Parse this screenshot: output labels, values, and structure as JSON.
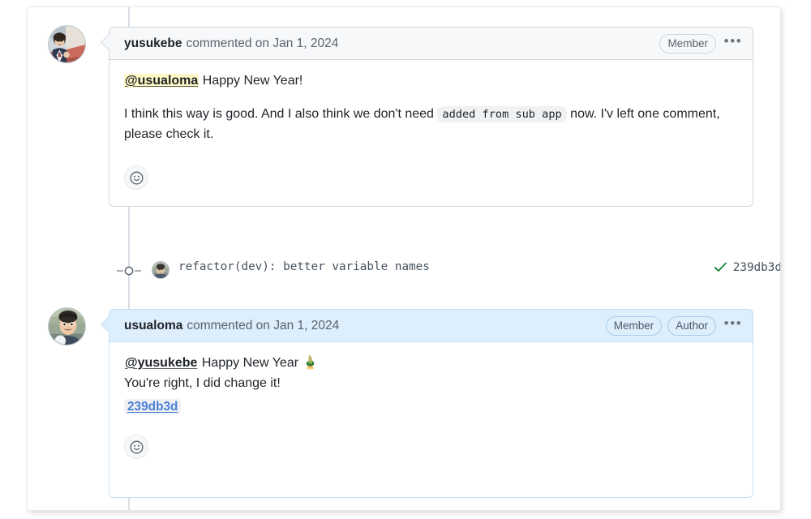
{
  "timeline": {
    "comments": [
      {
        "author": "yusukebe",
        "meta": "commented on Jan 1, 2024",
        "badges": [
          "Member"
        ],
        "kebab_label": "•••",
        "kebab_name": "comment-actions-menu",
        "highlight": "grey",
        "body": {
          "mention": "@usualoma",
          "greeting": " Happy New Year!",
          "paragraph_pre": "I think this way is good. And I also think we don't need ",
          "inline_code": "added from sub app",
          "paragraph_post": " now. I'v left one comment, please check it."
        },
        "reaction_icon": "smiley-face-icon"
      },
      {
        "author": "usualoma",
        "meta": "commented on Jan 1, 2024",
        "badges": [
          "Member",
          "Author"
        ],
        "kebab_label": "•••",
        "kebab_name": "comment-actions-menu",
        "highlight": "blue",
        "body": {
          "mention": "@yusukebe",
          "greeting": " Happy New Year ",
          "emoji": "🎍",
          "line2": "You're right, I did change it!",
          "sha_link": "239db3d"
        },
        "reaction_icon": "smiley-face-icon"
      }
    ],
    "commit_event": {
      "message": "refactor(dev): better variable names",
      "sha": "239db3d",
      "status_icon": "check-icon",
      "status_color": "#1a7f37",
      "node_icon": "commit-node-icon",
      "avatar_name": "commit-author-avatar"
    }
  },
  "colors": {
    "grey_header": "#f6f8fa",
    "grey_border": "#d0d7de",
    "blue_header": "#ddeefc",
    "blue_border": "#c6dff4",
    "mention_highlight": "#fff8c5",
    "link_blue": "#4a7fd6",
    "success_green": "#1a7f37",
    "spine": "#d8dee4"
  }
}
